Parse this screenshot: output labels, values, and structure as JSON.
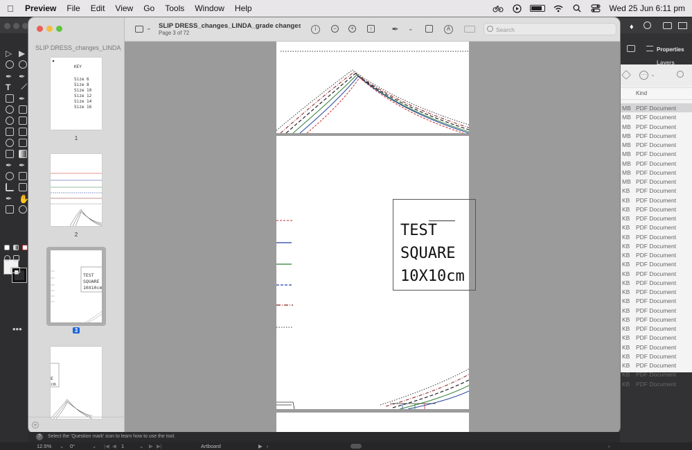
{
  "menubar": {
    "app_name": "Preview",
    "menus": [
      "File",
      "Edit",
      "View",
      "Go",
      "Tools",
      "Window",
      "Help"
    ],
    "clock": "Wed 25 Jun  6:11 pm"
  },
  "background_app": {
    "panel_properties": "Properties",
    "panel_layers": "Layers",
    "status_hint": "Select the 'Question mark' icon to learn how to use the tool.",
    "zoom": "12.5%",
    "rotation": "0°",
    "artboard_number": "1",
    "artboard_label": "Artboard"
  },
  "finder": {
    "column_kind": "Kind",
    "rows": [
      {
        "size": "MB",
        "kind": "PDF Document"
      },
      {
        "size": "MB",
        "kind": "PDF Document"
      },
      {
        "size": "MB",
        "kind": "PDF Document"
      },
      {
        "size": "MB",
        "kind": "PDF Document"
      },
      {
        "size": "MB",
        "kind": "PDF Document"
      },
      {
        "size": "MB",
        "kind": "PDF Document"
      },
      {
        "size": "MB",
        "kind": "PDF Document"
      },
      {
        "size": "MB",
        "kind": "PDF Document"
      },
      {
        "size": "MB",
        "kind": "PDF Document"
      },
      {
        "size": "KB",
        "kind": "PDF Document"
      },
      {
        "size": "KB",
        "kind": "PDF Document"
      },
      {
        "size": "KB",
        "kind": "PDF Document"
      },
      {
        "size": "KB",
        "kind": "PDF Document"
      },
      {
        "size": "KB",
        "kind": "PDF Document"
      },
      {
        "size": "KB",
        "kind": "PDF Document"
      },
      {
        "size": "KB",
        "kind": "PDF Document"
      },
      {
        "size": "KB",
        "kind": "PDF Document"
      },
      {
        "size": "KB",
        "kind": "PDF Document"
      },
      {
        "size": "KB",
        "kind": "PDF Document"
      },
      {
        "size": "KB",
        "kind": "PDF Document"
      },
      {
        "size": "KB",
        "kind": "PDF Document"
      },
      {
        "size": "KB",
        "kind": "PDF Document"
      },
      {
        "size": "KB",
        "kind": "PDF Document"
      },
      {
        "size": "KB",
        "kind": "PDF Document"
      },
      {
        "size": "KB",
        "kind": "PDF Document"
      },
      {
        "size": "KB",
        "kind": "PDF Document"
      },
      {
        "size": "KB",
        "kind": "PDF Document"
      },
      {
        "size": "KB",
        "kind": "PDF Document"
      },
      {
        "size": "KB",
        "kind": "PDF Document"
      },
      {
        "size": "KB",
        "kind": "PDF Document"
      },
      {
        "size": "KB",
        "kind": "PDF Document"
      }
    ]
  },
  "preview": {
    "sidebar_title": "SLIP DRESS_changes_LINDA_grade changes",
    "doc_title": "SLIP DRESS_changes_LINDA_grade changes...",
    "page_info": "Page 3 of 72",
    "search_placeholder": "Search",
    "thumbnails": [
      {
        "number": "1",
        "selected": false
      },
      {
        "number": "2",
        "selected": false
      },
      {
        "number": "3",
        "selected": true
      },
      {
        "number": "",
        "selected": false
      }
    ],
    "thumb1_key": {
      "title": "KEY",
      "sizes": [
        "Size 6",
        "Size 8",
        "Size 10",
        "Size 12",
        "Size 14",
        "Size 16"
      ]
    },
    "thumb3_text": [
      "TEST",
      "SQUARE",
      "10X10cm"
    ],
    "thumb4_text": [
      "E",
      "cm"
    ],
    "test_square": [
      "TEST",
      "SQUARE",
      "10X10cm"
    ]
  },
  "colors": {
    "size_lines": [
      "#333333",
      "#8b1a1a",
      "#222222",
      "#2e7d32",
      "#1f3fa0",
      "#c62828"
    ],
    "selection_blue": "#1a65d6"
  }
}
